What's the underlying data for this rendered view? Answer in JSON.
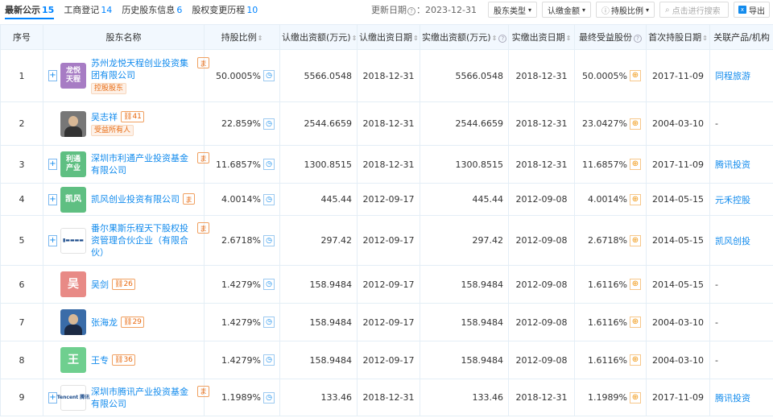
{
  "tabs": [
    {
      "label": "最新公示",
      "count": "15"
    },
    {
      "label": "工商登记",
      "count": "14"
    },
    {
      "label": "历史股东信息",
      "count": "6"
    },
    {
      "label": "股权变更历程",
      "count": "10"
    }
  ],
  "toolbar": {
    "update_label": "更新日期",
    "update_date": "2023-12-31",
    "filter_type": "股东类型",
    "filter_amount": "认缴金额",
    "filter_ratio": "持股比例",
    "search_placeholder": "点击进行搜索",
    "export": "导出"
  },
  "columns": [
    "序号",
    "股东名称",
    "持股比例",
    "认缴出资额(万元)",
    "认缴出资日期",
    "实缴出资额(万元)",
    "实缴出资日期",
    "最终受益股份",
    "首次持股日期",
    "关联产品/机构"
  ],
  "rows": [
    {
      "no": "1",
      "logo": "龙悦\n天程",
      "name": "苏州龙悦天程创业投资集团有限公司",
      "badge": "控股股东",
      "ratio": "50.0005%",
      "sub_amt": "5566.0548",
      "sub_date": "2018-12-31",
      "paid_amt": "5566.0548",
      "paid_date": "2018-12-31",
      "benefit": "50.0005%",
      "first_date": "2017-11-09",
      "product": "同程旅游"
    },
    {
      "no": "2",
      "logo": "",
      "name": "吴志祥",
      "tag": "41",
      "badge": "受益所有人",
      "ratio": "22.859%",
      "sub_amt": "2544.6659",
      "sub_date": "2018-12-31",
      "paid_amt": "2544.6659",
      "paid_date": "2018-12-31",
      "benefit": "23.0427%",
      "first_date": "2004-03-10",
      "product": "-"
    },
    {
      "no": "3",
      "logo": "利通\n产业",
      "name": "深圳市利通产业投资基金有限公司",
      "ratio": "11.6857%",
      "sub_amt": "1300.8515",
      "sub_date": "2018-12-31",
      "paid_amt": "1300.8515",
      "paid_date": "2018-12-31",
      "benefit": "11.6857%",
      "first_date": "2017-11-09",
      "product": "腾讯投资"
    },
    {
      "no": "4",
      "logo": "凯风",
      "name": "凯风创业投资有限公司",
      "ratio": "4.0014%",
      "sub_amt": "445.44",
      "sub_date": "2012-09-17",
      "paid_amt": "445.44",
      "paid_date": "2012-09-08",
      "benefit": "4.0014%",
      "first_date": "2014-05-15",
      "product": "元禾控股"
    },
    {
      "no": "5",
      "logo": "",
      "name": "番尔果斯乐程天下股权投资管理合伙企业（有限合伙）",
      "ratio": "2.6718%",
      "sub_amt": "297.42",
      "sub_date": "2012-09-17",
      "paid_amt": "297.42",
      "paid_date": "2012-09-08",
      "benefit": "2.6718%",
      "first_date": "2014-05-15",
      "product": "凯风创投"
    },
    {
      "no": "6",
      "logo": "吴",
      "name": "吴剑",
      "tag": "26",
      "ratio": "1.4279%",
      "sub_amt": "158.9484",
      "sub_date": "2012-09-17",
      "paid_amt": "158.9484",
      "paid_date": "2012-09-08",
      "benefit": "1.6116%",
      "first_date": "2014-05-15",
      "product": "-"
    },
    {
      "no": "7",
      "logo": "",
      "name": "张海龙",
      "tag": "29",
      "ratio": "1.4279%",
      "sub_amt": "158.9484",
      "sub_date": "2012-09-17",
      "paid_amt": "158.9484",
      "paid_date": "2012-09-08",
      "benefit": "1.6116%",
      "first_date": "2004-03-10",
      "product": "-"
    },
    {
      "no": "8",
      "logo": "王",
      "name": "王专",
      "tag": "36",
      "ratio": "1.4279%",
      "sub_amt": "158.9484",
      "sub_date": "2012-09-17",
      "paid_amt": "158.9484",
      "paid_date": "2012-09-08",
      "benefit": "1.6116%",
      "first_date": "2004-03-10",
      "product": "-"
    },
    {
      "no": "9",
      "logo": "Tencent 腾讯",
      "name": "深圳市腾讯产业投资基金有限公司",
      "ratio": "1.1989%",
      "sub_amt": "133.46",
      "sub_date": "2018-12-31",
      "paid_amt": "133.46",
      "paid_date": "2018-12-31",
      "benefit": "1.1989%",
      "first_date": "2017-11-09",
      "product": "腾讯投资"
    }
  ],
  "colors": {
    "link": "#128bed",
    "header_bg": "#f2f8fe",
    "accent": "#0084ff"
  }
}
